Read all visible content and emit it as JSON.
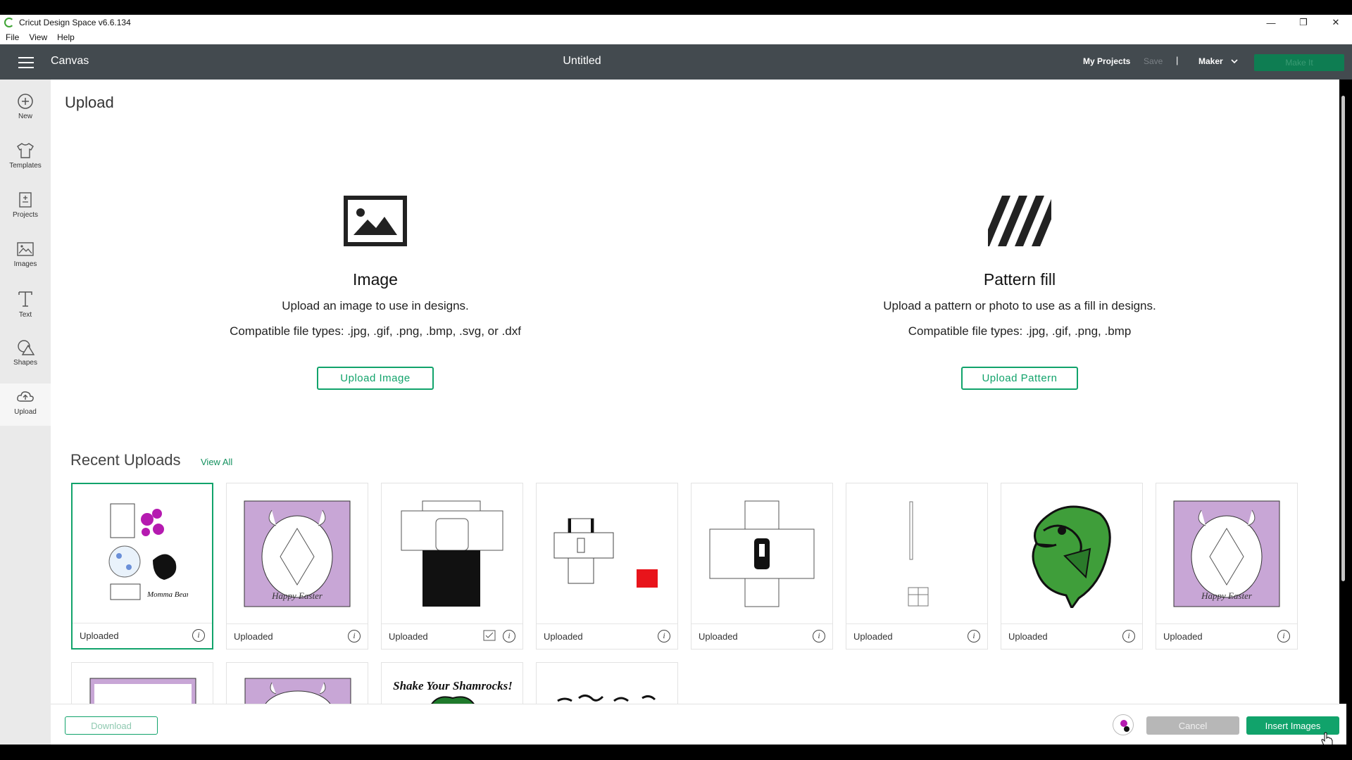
{
  "window": {
    "title": "Cricut Design Space  v6.6.134",
    "controls": {
      "minimize": "—",
      "restore": "❐",
      "close": "✕"
    }
  },
  "menu": [
    "File",
    "View",
    "Help"
  ],
  "header": {
    "canvas_label": "Canvas",
    "doc_title": "Untitled",
    "my_projects": "My Projects",
    "save": "Save",
    "separator": "|",
    "machine": "Maker",
    "make_it": "Make It"
  },
  "sidebar": [
    {
      "label": "New",
      "icon": "plus-circle-icon"
    },
    {
      "label": "Templates",
      "icon": "tshirt-icon"
    },
    {
      "label": "Projects",
      "icon": "projects-icon"
    },
    {
      "label": "Images",
      "icon": "image-icon"
    },
    {
      "label": "Text",
      "icon": "text-icon"
    },
    {
      "label": "Shapes",
      "icon": "shapes-icon"
    },
    {
      "label": "Upload",
      "icon": "cloud-upload-icon",
      "active": true
    }
  ],
  "page": {
    "title": "Upload"
  },
  "image_section": {
    "title": "Image",
    "desc": "Upload an image to use in designs.",
    "types": "Compatible file types: .jpg, .gif, .png, .bmp, .svg, or .dxf",
    "button": "Upload Image"
  },
  "pattern_section": {
    "title": "Pattern fill",
    "desc": "Upload a pattern or photo to use as a fill in designs.",
    "types": "Compatible file types: .jpg, .gif, .png, .bmp",
    "button": "Upload Pattern"
  },
  "recent": {
    "title": "Recent Uploads",
    "view_all": "View All",
    "items": [
      {
        "label": "Uploaded",
        "thumb": "floral-mothers-day-set",
        "selected": true
      },
      {
        "label": "Uploaded",
        "thumb": "happy-easter-card"
      },
      {
        "label": "Uploaded",
        "thumb": "black-box-template",
        "checkbox": true
      },
      {
        "label": "Uploaded",
        "thumb": "box-net-red-square"
      },
      {
        "label": "Uploaded",
        "thumb": "box-net-outline"
      },
      {
        "label": "Uploaded",
        "thumb": "thin-line-window"
      },
      {
        "label": "Uploaded",
        "thumb": "green-bass-fish"
      },
      {
        "label": "Uploaded",
        "thumb": "happy-easter-card"
      }
    ],
    "row2": [
      {
        "thumb": "purple-frame"
      },
      {
        "thumb": "happy-easter-card"
      },
      {
        "thumb": "shake-your-shamrocks",
        "text": "Shake Your Shamrocks!"
      },
      {
        "thumb": "script-text"
      }
    ],
    "thumb_text": {
      "easter": "Happy Easter",
      "momma": "Momma Bear"
    }
  },
  "footer": {
    "download": "Download",
    "cancel": "Cancel",
    "insert": "Insert Images"
  },
  "colors": {
    "header": "#434a4f",
    "accent": "#11a36b",
    "lavender": "#c8a6d6"
  }
}
